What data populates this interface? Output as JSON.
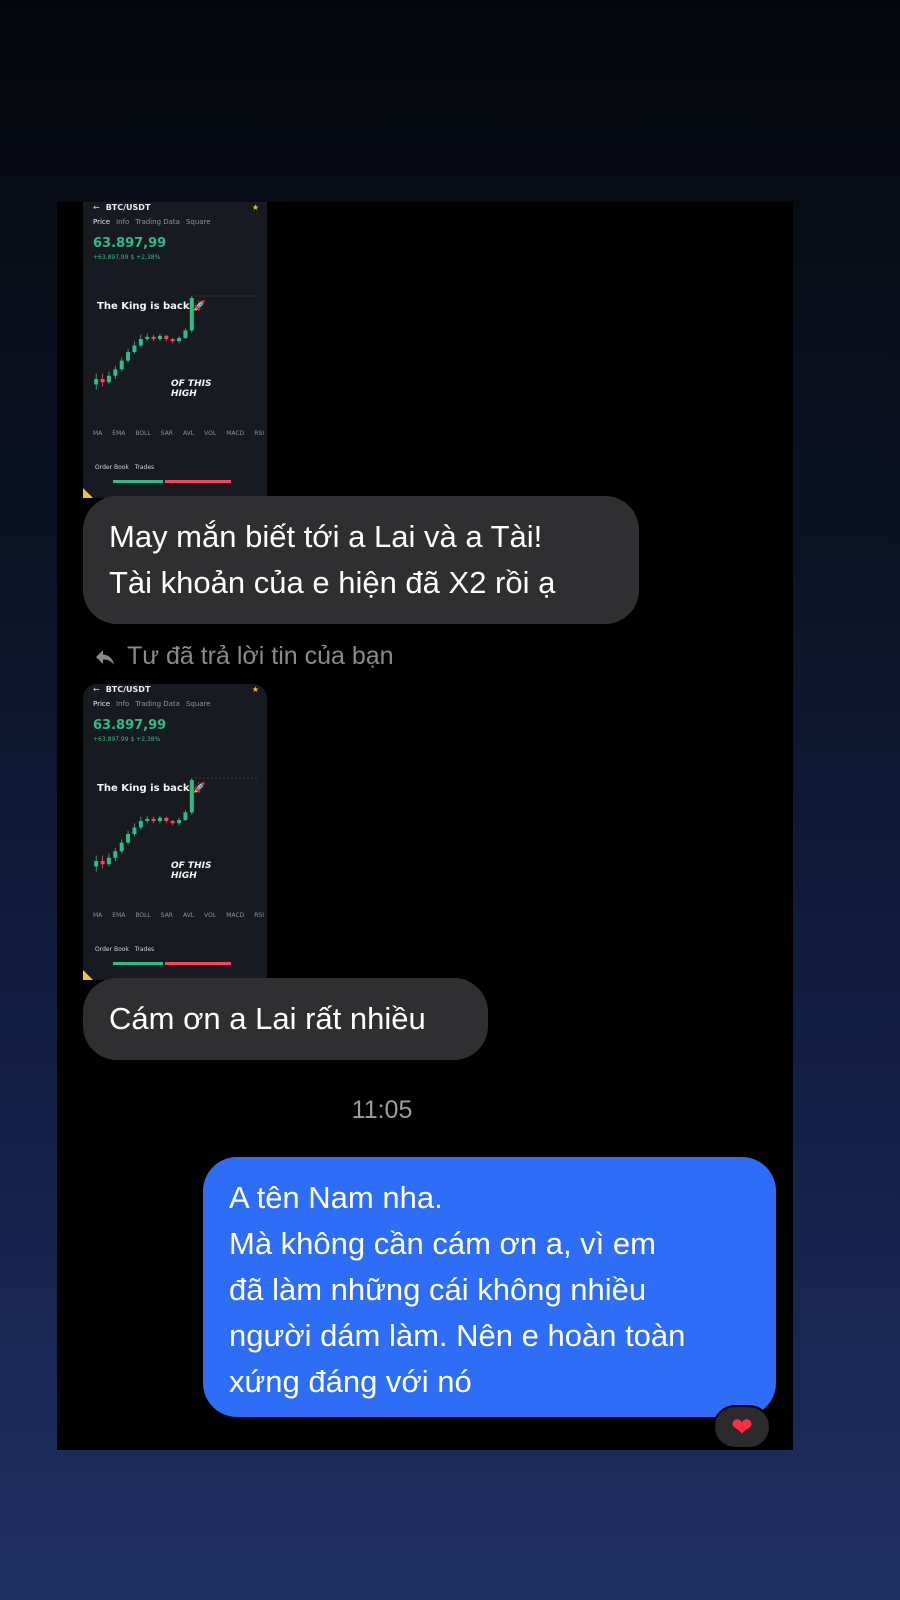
{
  "messages": {
    "image1": {
      "pair": "BTC/USDT",
      "tabs": [
        "Price",
        "Info",
        "Trading Data",
        "Square"
      ],
      "price": "63.897,99",
      "change": "+63.897,99 $ +2,38%",
      "caption_top": "The King is back",
      "caption_bottom": [
        "OF THIS",
        "HIGH"
      ],
      "indicators": [
        "MA",
        "EMA",
        "BOLL",
        "SAR",
        "AVL",
        "VOL",
        "MACD",
        "RSI"
      ],
      "order_book_label": "Order Book",
      "trades_label": "Trades"
    },
    "bubble1_lines": [
      "May mắn biết tới a Lai và a Tài!",
      "Tài khoản của e hiện đã X2 rồi ạ"
    ],
    "reply_note": "Tư đã trả lời tin của bạn",
    "image2": {
      "pair": "BTC/USDT",
      "tabs": [
        "Price",
        "Info",
        "Trading Data",
        "Square"
      ],
      "price": "63.897,99",
      "change": "+63.897,99 $ +2,38%",
      "caption_top": "The King is back",
      "caption_bottom": [
        "OF THIS",
        "HIGH"
      ],
      "indicators": [
        "MA",
        "EMA",
        "BOLL",
        "SAR",
        "AVL",
        "VOL",
        "MACD",
        "RSI"
      ],
      "order_book_label": "Order Book",
      "trades_label": "Trades"
    },
    "bubble2_lines": [
      "Cám ơn a Lai rất nhiều"
    ],
    "timestamp": "11:05",
    "outgoing_lines": [
      "A tên Nam nha.",
      "Mà không cần cám ơn a, vì em",
      "đã làm những cái không nhiều",
      "người dám làm. Nên e hoàn toàn",
      "xứng đáng với nó"
    ],
    "reaction_icon": "heart-reaction"
  },
  "colors": {
    "incoming_bubble": "#2f2f31",
    "outgoing_bubble": "#2e6df6",
    "price_green": "#2ebd85",
    "price_red": "#f6465d"
  }
}
